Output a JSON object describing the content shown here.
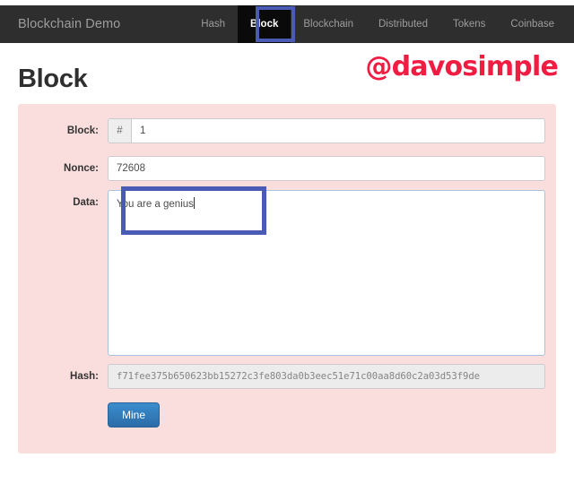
{
  "navbar": {
    "brand": "Blockchain Demo",
    "items": [
      {
        "label": "Hash",
        "active": false
      },
      {
        "label": "Block",
        "active": true
      },
      {
        "label": "Blockchain",
        "active": false
      },
      {
        "label": "Distributed",
        "active": false
      },
      {
        "label": "Tokens",
        "active": false
      },
      {
        "label": "Coinbase",
        "active": false
      }
    ]
  },
  "page": {
    "title": "Block",
    "watermark": "@davosimple"
  },
  "form": {
    "block": {
      "label": "Block:",
      "addon": "#",
      "value": "1",
      "placeholder": ""
    },
    "nonce": {
      "label": "Nonce:",
      "value": "72608",
      "placeholder": ""
    },
    "data": {
      "label": "Data:",
      "value": "You are a genius",
      "placeholder": ""
    },
    "hash": {
      "label": "Hash:",
      "value": "f71fee375b650623bb15272c3fe803da0b3eec51e71c00aa8d60c2a03d53f9de",
      "placeholder": ""
    },
    "mine_button": "Mine"
  },
  "colors": {
    "navbar_bg": "#2e2e2e",
    "active_tab_bg": "#0a0a0a",
    "annotation_blue": "#4a5bb5",
    "panel_bg": "#f9dedd",
    "watermark_red": "#f01d43",
    "mine_blue": "#2e7ab8"
  }
}
